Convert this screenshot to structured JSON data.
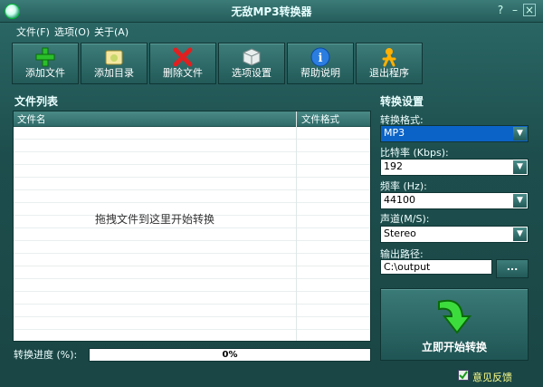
{
  "window": {
    "title": "无敌MP3转换器"
  },
  "menu": [
    "文件(F)",
    "选项(O)",
    "关于(A)"
  ],
  "toolbar": [
    {
      "label": "添加文件",
      "icon": "green-plus-icon"
    },
    {
      "label": "添加目录",
      "icon": "folder-icon"
    },
    {
      "label": "删除文件",
      "icon": "red-x-icon"
    },
    {
      "label": "选项设置",
      "icon": "cube-icon"
    },
    {
      "label": "帮助说明",
      "icon": "info-icon"
    },
    {
      "label": "退出程序",
      "icon": "exit-person-icon"
    }
  ],
  "file_list": {
    "title": "文件列表",
    "columns": [
      "文件名",
      "文件格式"
    ],
    "hint": "拖拽文件到这里开始转换"
  },
  "progress": {
    "label": "转换进度 (%):",
    "value": 0,
    "text": "0%"
  },
  "settings": {
    "title": "转换设置",
    "format_label": "转换格式:",
    "format_value": "MP3",
    "bitrate_label": "比特率 (Kbps):",
    "bitrate_value": "192",
    "freq_label": "频率 (Hz):",
    "freq_value": "44100",
    "channel_label": "声道(M/S):",
    "channel_value": "Stereo",
    "output_label": "输出路径:",
    "output_value": "C:\\output",
    "browse_label": "...",
    "convert_label": "立即开始转换"
  },
  "feedback": "意见反馈",
  "colors": {
    "accent": "#1f4f4f",
    "selection": "#0b63c7"
  }
}
